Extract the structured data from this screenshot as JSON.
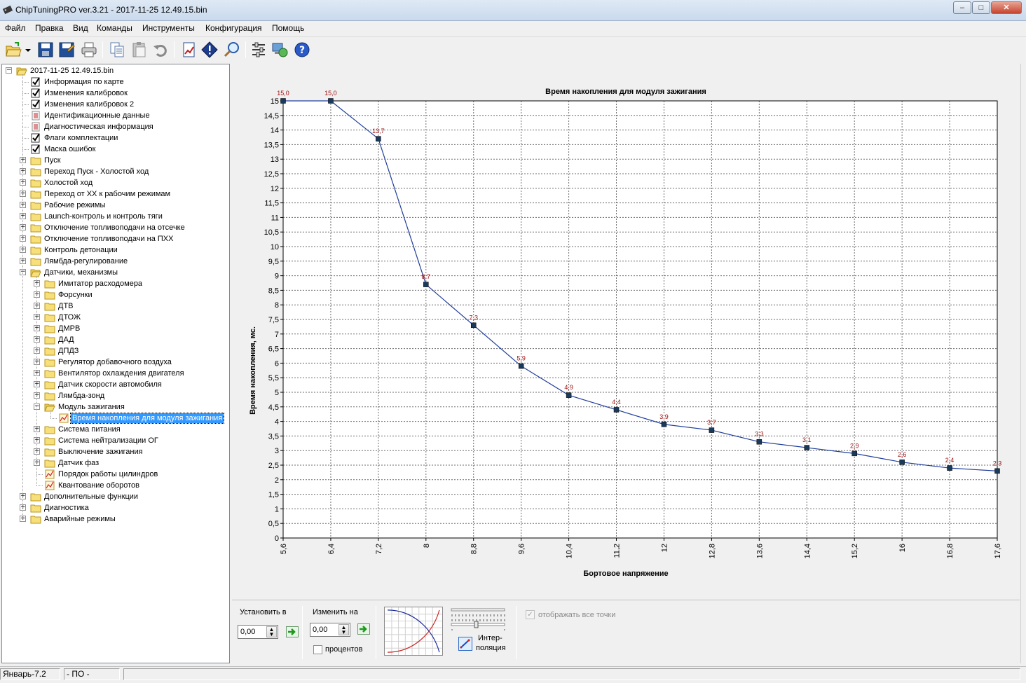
{
  "window": {
    "title": "ChipTuningPRO ver.3.21 - 2017-11-25 12.49.15.bin",
    "min_label": "–",
    "max_label": "□",
    "close_label": "✕"
  },
  "menu": [
    "Файл",
    "Правка",
    "Вид",
    "Команды",
    "Инструменты",
    "Конфигурация",
    "Помощь"
  ],
  "toolbar_icons": [
    "open-icon",
    "dropdown-arrow-icon",
    "save-icon",
    "save-as-icon",
    "print-icon",
    "copy-icon",
    "paste-icon",
    "undo-icon",
    "report-icon",
    "info-icon",
    "search-icon",
    "settings-icon",
    "network-icon",
    "help-icon"
  ],
  "tree": {
    "root": "2017-11-25 12.49.15.bin",
    "items": [
      {
        "label": "Информация по карте",
        "level": 1,
        "icon": "check",
        "exp": ""
      },
      {
        "label": "Изменения калибровок",
        "level": 1,
        "icon": "check",
        "exp": ""
      },
      {
        "label": "Изменения калибровок 2",
        "level": 1,
        "icon": "check",
        "exp": ""
      },
      {
        "label": "Идентификационные данные",
        "level": 1,
        "icon": "doc",
        "exp": ""
      },
      {
        "label": "Диагностическая информация",
        "level": 1,
        "icon": "doc",
        "exp": ""
      },
      {
        "label": "Флаги комплектации",
        "level": 1,
        "icon": "check",
        "exp": ""
      },
      {
        "label": "Маска ошибок",
        "level": 1,
        "icon": "check",
        "exp": ""
      },
      {
        "label": "Пуск",
        "level": 1,
        "icon": "folder",
        "exp": "+"
      },
      {
        "label": "Переход Пуск - Холостой ход",
        "level": 1,
        "icon": "folder",
        "exp": "+"
      },
      {
        "label": "Холостой ход",
        "level": 1,
        "icon": "folder",
        "exp": "+"
      },
      {
        "label": "Переход от ХХ к рабочим режимам",
        "level": 1,
        "icon": "folder",
        "exp": "+"
      },
      {
        "label": "Рабочие режимы",
        "level": 1,
        "icon": "folder",
        "exp": "+"
      },
      {
        "label": "Launch-контроль и контроль тяги",
        "level": 1,
        "icon": "folder",
        "exp": "+"
      },
      {
        "label": "Отключение топливоподачи на отсечке",
        "level": 1,
        "icon": "folder",
        "exp": "+"
      },
      {
        "label": "Отключение топливоподачи на ПХХ",
        "level": 1,
        "icon": "folder",
        "exp": "+"
      },
      {
        "label": "Контроль детонации",
        "level": 1,
        "icon": "folder",
        "exp": "+"
      },
      {
        "label": "Лямбда-регулирование",
        "level": 1,
        "icon": "folder",
        "exp": "+"
      },
      {
        "label": "Датчики, механизмы",
        "level": 1,
        "icon": "folder-open",
        "exp": "-"
      },
      {
        "label": "Имитатор расходомера",
        "level": 2,
        "icon": "folder",
        "exp": "+"
      },
      {
        "label": "Форсунки",
        "level": 2,
        "icon": "folder",
        "exp": "+"
      },
      {
        "label": "ДТВ",
        "level": 2,
        "icon": "folder",
        "exp": "+"
      },
      {
        "label": "ДТОЖ",
        "level": 2,
        "icon": "folder",
        "exp": "+"
      },
      {
        "label": "ДМРВ",
        "level": 2,
        "icon": "folder",
        "exp": "+"
      },
      {
        "label": "ДАД",
        "level": 2,
        "icon": "folder",
        "exp": "+"
      },
      {
        "label": "ДПДЗ",
        "level": 2,
        "icon": "folder",
        "exp": "+"
      },
      {
        "label": "Регулятор добавочного воздуха",
        "level": 2,
        "icon": "folder",
        "exp": "+"
      },
      {
        "label": "Вентилятор охлаждения двигателя",
        "level": 2,
        "icon": "folder",
        "exp": "+"
      },
      {
        "label": "Датчик скорости автомобиля",
        "level": 2,
        "icon": "folder",
        "exp": "+"
      },
      {
        "label": "Лямбда-зонд",
        "level": 2,
        "icon": "folder",
        "exp": "+"
      },
      {
        "label": "Модуль зажигания",
        "level": 2,
        "icon": "folder-open",
        "exp": "-"
      },
      {
        "label": "Время накопления для модуля зажигания",
        "level": 3,
        "icon": "chart",
        "exp": "",
        "selected": true
      },
      {
        "label": "Система питания",
        "level": 2,
        "icon": "folder",
        "exp": "+"
      },
      {
        "label": "Система нейтрализации ОГ",
        "level": 2,
        "icon": "folder",
        "exp": "+"
      },
      {
        "label": "Выключение зажигания",
        "level": 2,
        "icon": "folder",
        "exp": "+"
      },
      {
        "label": "Датчик фаз",
        "level": 2,
        "icon": "folder",
        "exp": "+"
      },
      {
        "label": "Порядок работы цилиндров",
        "level": 2,
        "icon": "chart",
        "exp": ""
      },
      {
        "label": "Квантование оборотов",
        "level": 2,
        "icon": "chart",
        "exp": ""
      },
      {
        "label": "Дополнительные функции",
        "level": 1,
        "icon": "folder",
        "exp": "+"
      },
      {
        "label": "Диагностика",
        "level": 1,
        "icon": "folder",
        "exp": "+"
      },
      {
        "label": "Аварийные режимы",
        "level": 1,
        "icon": "folder",
        "exp": "+"
      }
    ]
  },
  "chart_data": {
    "type": "line",
    "title": "Время накопления для модуля зажигания",
    "xlabel": "Бортовое напряжение",
    "ylabel": "Время накопления, мс.",
    "x": [
      "5,6",
      "6,4",
      "7,2",
      "8",
      "8,8",
      "9,6",
      "10,4",
      "11,2",
      "12",
      "12,8",
      "13,6",
      "14,4",
      "15,2",
      "16",
      "16,8",
      "17,6"
    ],
    "values": [
      15.0,
      15.0,
      13.7,
      8.7,
      7.3,
      5.9,
      4.9,
      4.4,
      3.9,
      3.7,
      3.3,
      3.1,
      2.9,
      2.6,
      2.4,
      2.3
    ],
    "point_labels": [
      "15,0",
      "15,0",
      "13,7",
      "8,7",
      "7,3",
      "5,9",
      "4,9",
      "4,4",
      "3,9",
      "3,7",
      "3,3",
      "3,1",
      "2,9",
      "2,6",
      "2,4",
      "2,3"
    ],
    "yticks": [
      "0",
      "0,5",
      "1",
      "1,5",
      "2",
      "2,5",
      "3",
      "3,5",
      "4",
      "4,5",
      "5",
      "5,5",
      "6",
      "6,5",
      "7",
      "7,5",
      "8",
      "8,5",
      "9",
      "9,5",
      "10",
      "10,5",
      "11",
      "11,5",
      "12",
      "12,5",
      "13",
      "13,5",
      "14",
      "14,5",
      "15"
    ],
    "ylim": [
      0,
      15
    ],
    "grid": true,
    "colors": {
      "line": "#1f3d9a",
      "marker": "#1a3a5c",
      "label": "#a01010",
      "grid": "#6e6e6e"
    }
  },
  "bottom": {
    "set_label": "Установить в",
    "set_value": "0,00",
    "change_label": "Изменить на",
    "change_value": "0,00",
    "percent_label": "процентов",
    "interp_label1": "Интер-",
    "interp_label2": "поляция",
    "show_all_label": "отображать все точки"
  },
  "status": {
    "cell1": "Январь-7.2",
    "cell2": "- ПО -"
  }
}
